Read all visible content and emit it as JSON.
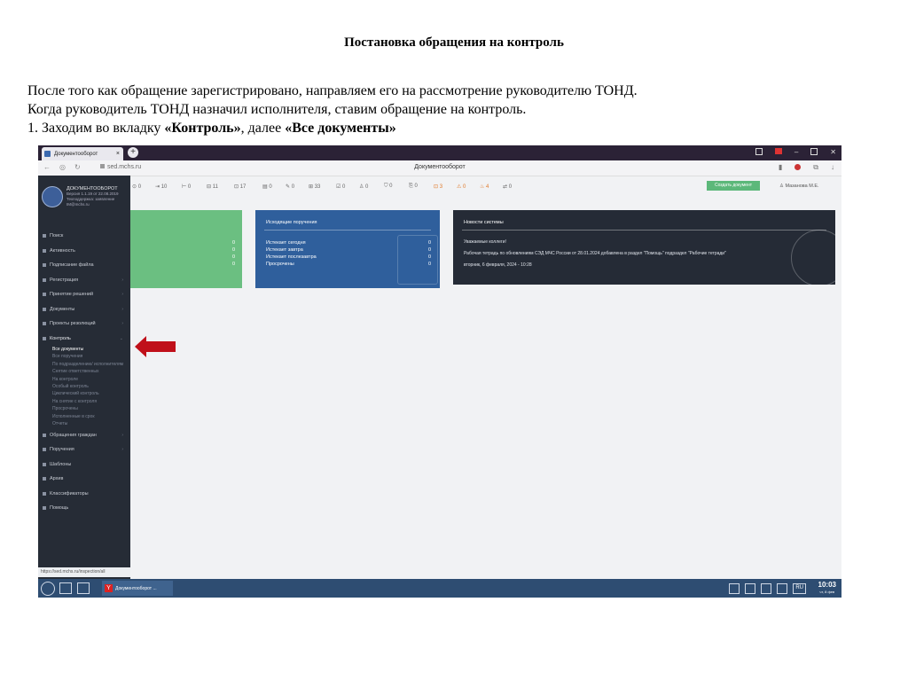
{
  "slide": {
    "title": "Постановка обращения на контроль",
    "line1": "После того как обращение зарегистрировано, направляем его на рассмотрение руководителю ТОНД.",
    "line2": "Когда руководитель ТОНД назначил исполнителя, ставим обращение на контроль.",
    "line3_prefix": "1. Заходим во вкладку ",
    "line3_tab": "«Контроль»",
    "line3_mid": ", далее ",
    "line3_sub": "«Все документы»"
  },
  "browser": {
    "tab_title": "Документооборот",
    "tab_close": "×",
    "new_tab": "+",
    "url": "sed.mchs.ru",
    "page_title": "Документооборот"
  },
  "sidebar": {
    "brand_name": "ДОКУМЕНТООБОРОТ",
    "brand_line2": "Версия 1.1.19 от 22.08.2019",
    "brand_line3": "Техподдержка: заявление",
    "brand_line4": "IM@mchs.ru",
    "items_top": [
      "Поиск",
      "Активность",
      "Подписание файла",
      "Регистрация",
      "Принятие решений",
      "Документы",
      "Проекты резолюций"
    ],
    "control_label": "Контроль",
    "control_subitems": [
      "Все документы",
      "Все поручения",
      "По подразделению/ исполнителям",
      "Снятие ответственных",
      "На контроле",
      "Особый контроль",
      "Циклический контроль",
      "На снятие с контроля",
      "Просрочены",
      "Исполненные в срок",
      "Отчеты"
    ],
    "items_bottom": [
      "Обращения граждан",
      "Поручения",
      "Шаблоны",
      "Архив",
      "Классификаторы",
      "Помощь"
    ],
    "status_url": "https://sed.mchs.ru/inspection/all"
  },
  "toolbar": {
    "counters": [
      "0",
      "10",
      "0",
      "11",
      "17",
      "0",
      "0",
      "33",
      "0",
      "0",
      "0",
      "0",
      "3",
      "0",
      "4",
      "0"
    ],
    "create_button": "Создать документ",
    "user": "Мазанова М.Е."
  },
  "cards": {
    "green_values": [
      "0",
      "0",
      "0",
      "0"
    ],
    "outgoing": {
      "title": "Исходящие поручения",
      "rows": [
        {
          "label": "Истекает сегодня",
          "value": "0"
        },
        {
          "label": "Истекает завтра",
          "value": "0"
        },
        {
          "label": "Истекает послезавтра",
          "value": "0"
        },
        {
          "label": "Просрочены",
          "value": "0"
        }
      ]
    },
    "news": {
      "title": "Новости системы",
      "greeting": "Уважаемые коллеги!",
      "text": "Рабочая тетрадь по обновлениям СЭД МЧС России от 28.01.2024 добавлена в раздел \"Помощь\" подраздел \"Рабочие тетради\"",
      "date": "вторник, 6 февраля, 2024 - 10:28"
    }
  },
  "taskbar": {
    "task_label": "Документооборот ...",
    "lang": "RU",
    "time": "10:03",
    "date": "чт, 8 фев"
  },
  "colors": {
    "sidebar_bg": "#262c36",
    "green_card": "#6bbf81",
    "blue_card": "#2f5f9c",
    "news_card": "#252b36",
    "arrow": "#c0101a",
    "taskbar": "#2e4d72"
  }
}
